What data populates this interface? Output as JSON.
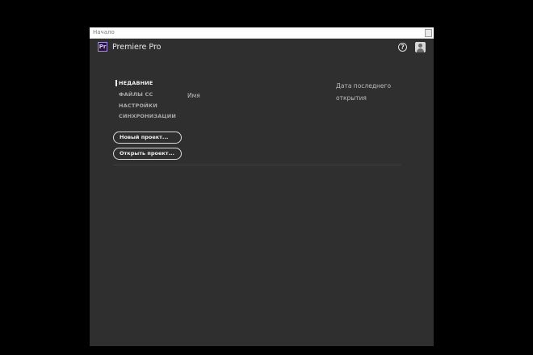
{
  "window": {
    "title": "Начало"
  },
  "app": {
    "logo_text": "Pr",
    "name": "Premiere Pro",
    "help_icon": "question-circle-icon",
    "user_icon": "user-avatar-icon"
  },
  "nav": {
    "items": [
      {
        "label": "НЕДАВНИЕ",
        "active": true
      },
      {
        "label": "ФАЙЛЫ CC",
        "active": false
      },
      {
        "label": "НАСТРОЙКИ",
        "active": false
      },
      {
        "label": "СИНХРОНИЗАЦИИ",
        "active": false
      }
    ]
  },
  "actions": {
    "new_project": "Новый проект...",
    "open_project": "Открыть проект..."
  },
  "table": {
    "columns": {
      "name": "Имя",
      "last_opened": "Дата последнего открытия"
    },
    "rows": []
  },
  "colors": {
    "background": "#2f2f2f",
    "accent_logo": "#a58cdc"
  }
}
